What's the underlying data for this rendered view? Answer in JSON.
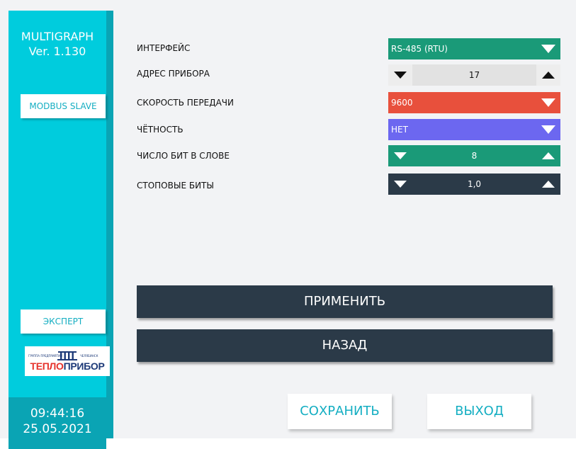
{
  "app": {
    "title_line1": "MULTIGRAPH",
    "title_line2": "Ver. 1.130"
  },
  "sidebar": {
    "modbus_label": "MODBUS SLAVE",
    "expert_label": "ЭКСПЕРТ",
    "logo": {
      "brand_part1": "ТЕПЛО",
      "brand_part2": "ПРИБОР",
      "tagline_left": "ГРУППА ПРЕДПРИЯТИЙ",
      "tagline_right": "ЧЕЛЯБИНСК"
    },
    "clock": {
      "time": "09:44:16",
      "date": "25.05.2021"
    }
  },
  "settings": {
    "interface": {
      "label": "ИНТЕРФЕЙС",
      "value": "RS-485 (RTU)"
    },
    "address": {
      "label": "АДРЕС ПРИБОРА",
      "value": "17"
    },
    "baud": {
      "label": "СКОРОСТЬ ПЕРЕДАЧИ",
      "value": "9600"
    },
    "parity": {
      "label": "ЧЁТНОСТЬ",
      "value": "НЕТ"
    },
    "data_bits": {
      "label": "ЧИСЛО БИТ В СЛОВЕ",
      "value": "8"
    },
    "stop_bits": {
      "label": "СТОПОВЫЕ БИТЫ",
      "value": "1,0"
    }
  },
  "actions": {
    "apply": "ПРИМЕНИТЬ",
    "back": "НАЗАД",
    "save": "СОХРАНИТЬ",
    "exit": "ВЫХОД"
  },
  "colors": {
    "sidebar": "#00ccdd",
    "interface_bg": "#1a9a78",
    "baud_bg": "#e8503c",
    "parity_bg": "#6c67f0",
    "data_bits_bg": "#1a9a78",
    "stop_bits_bg": "#2b3a48",
    "address_bg": "#e2e2e2",
    "dark_button": "#2b3a48",
    "accent_text": "#14aec2"
  }
}
